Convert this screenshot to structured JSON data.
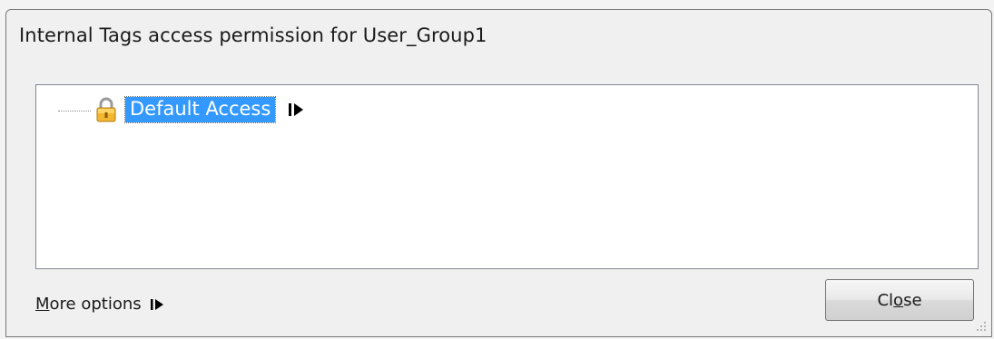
{
  "window": {
    "title": "Internal Tags access permission for User_Group1"
  },
  "tree": {
    "nodes": [
      {
        "label": "Default Access",
        "icon": "lock-icon",
        "expander": "play-icon",
        "selected": true
      }
    ]
  },
  "footer": {
    "more_options_prefix": "M",
    "more_options_rest": "ore options",
    "close_prefix": "Cl",
    "close_accel": "o",
    "close_rest": "se"
  },
  "colors": {
    "selection": "#3399ff",
    "background": "#f0f0f0"
  }
}
